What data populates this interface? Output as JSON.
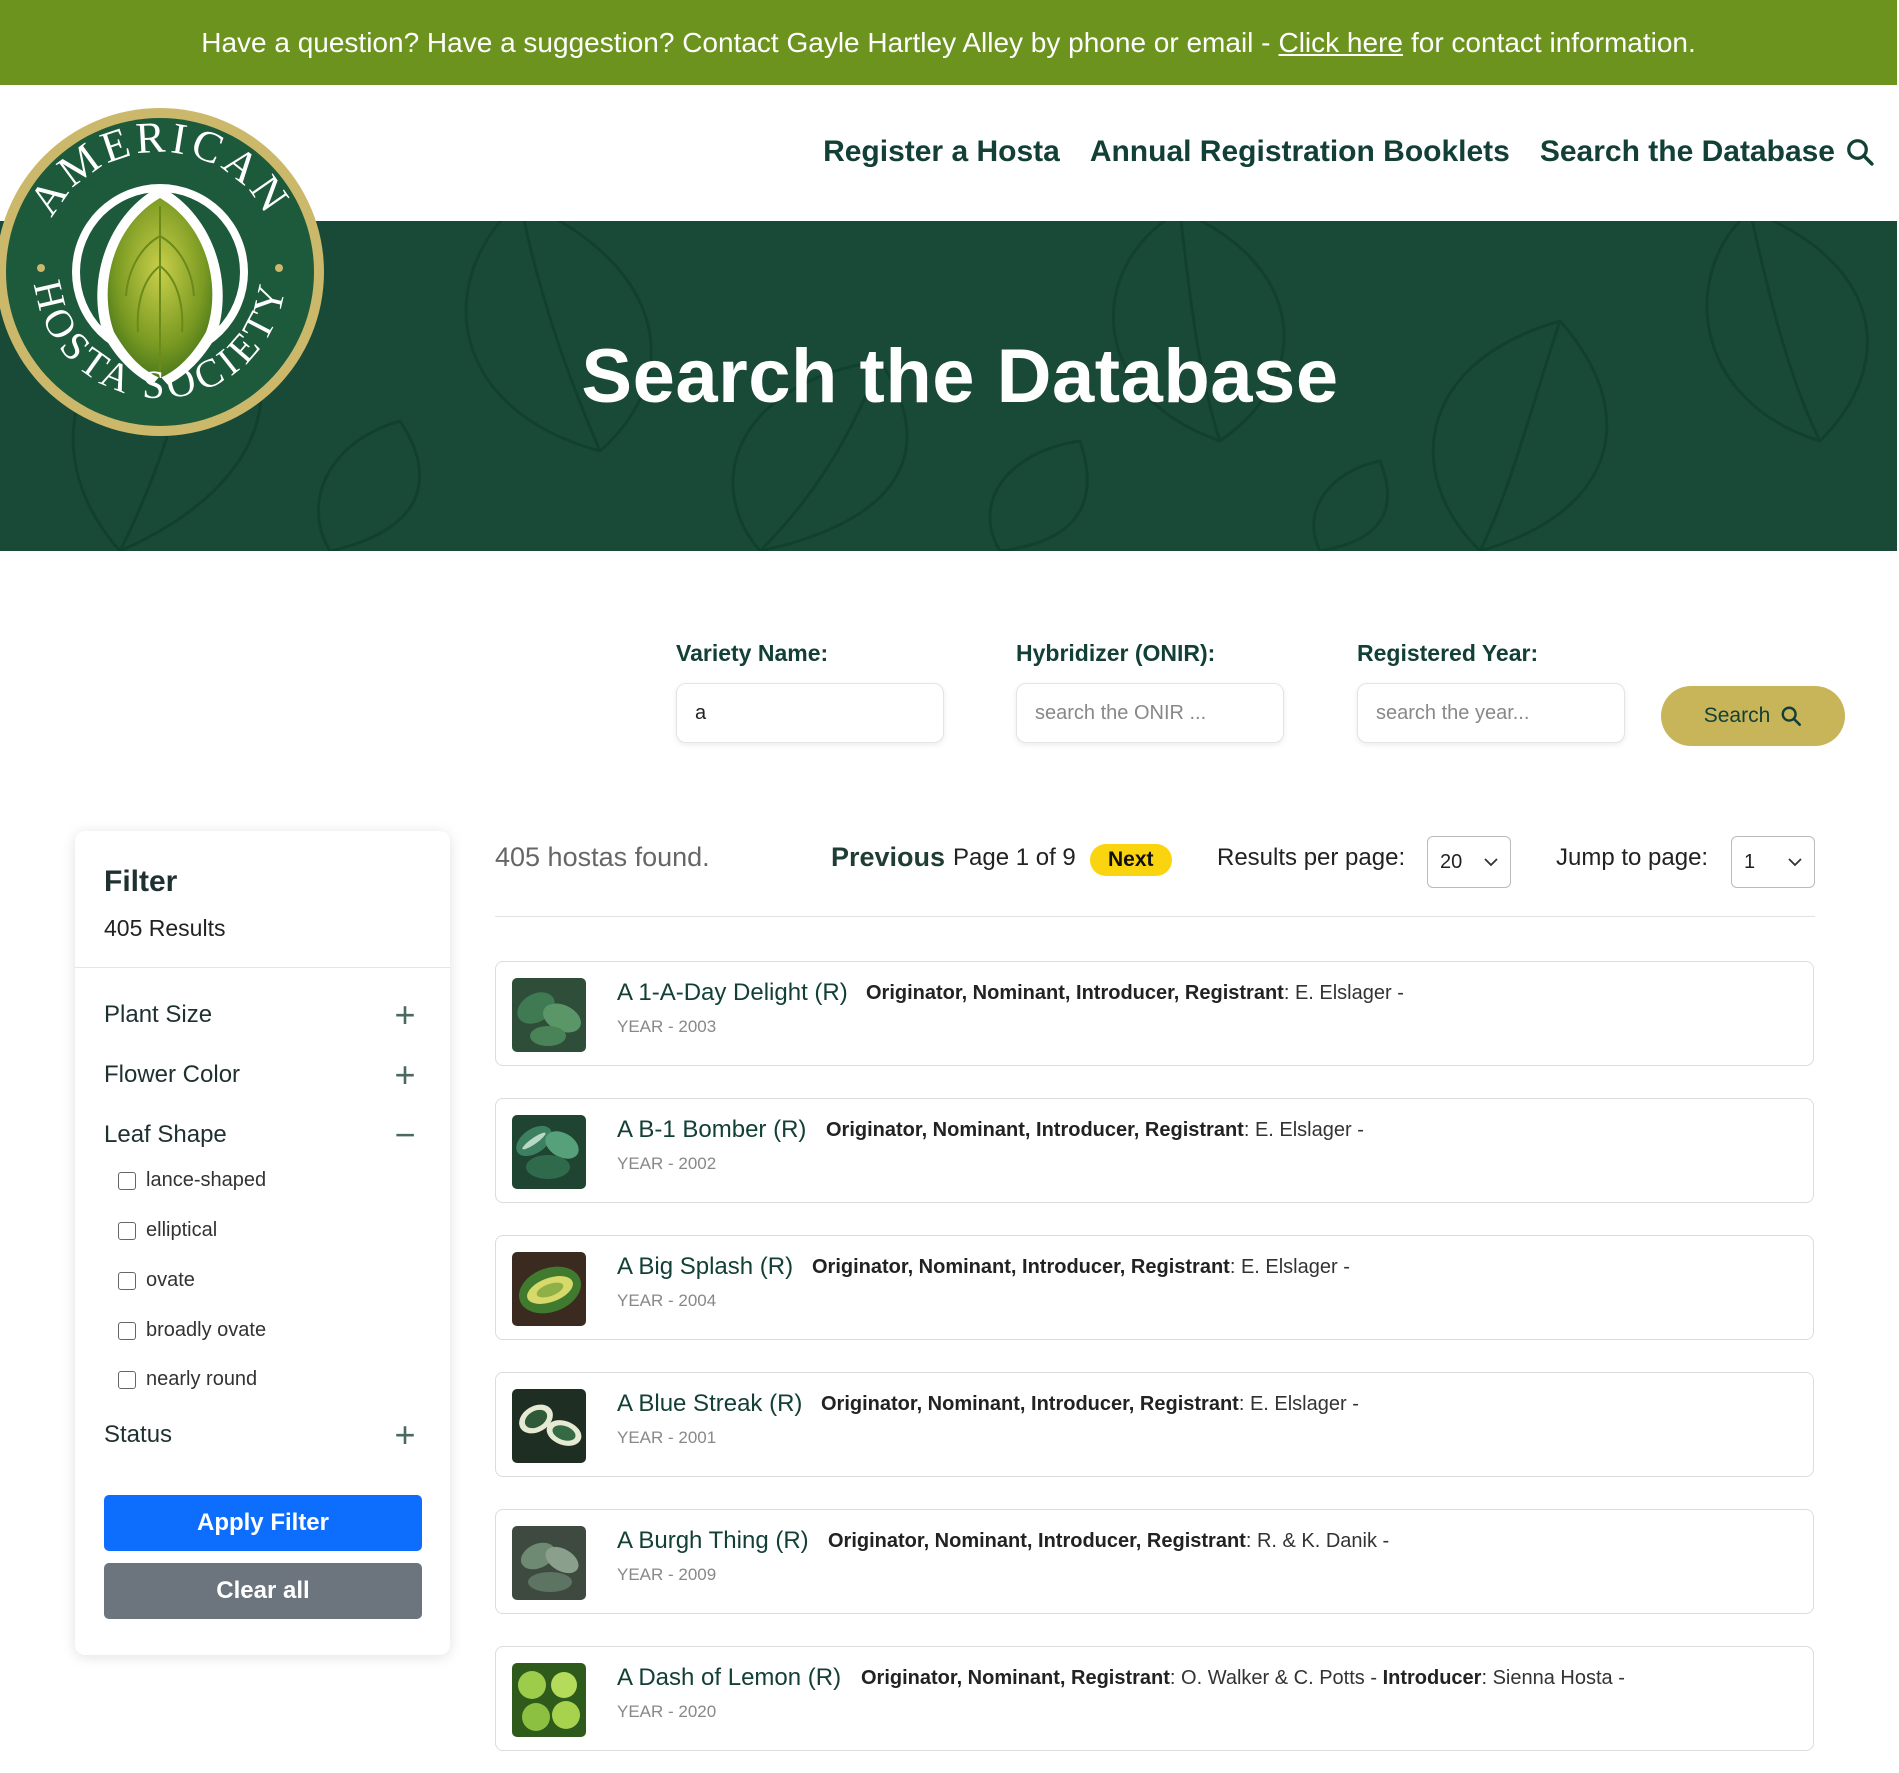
{
  "banner": {
    "text_before": "Have a question? Have a suggestion? Contact Gayle Hartley Alley by phone or email -",
    "link": "Click here",
    "text_after": "for contact information."
  },
  "logo": {
    "text": "AMERICAN HOSTA SOCIETY"
  },
  "nav": {
    "items": [
      "Register a Hosta",
      "Annual Registration Booklets",
      "Search the Database"
    ]
  },
  "hero": {
    "title": "Search the Database"
  },
  "search": {
    "variety_label": "Variety Name:",
    "variety_value": "a",
    "hybridizer_label": "Hybridizer (ONIR):",
    "hybridizer_placeholder": "search the ONIR ...",
    "year_label": "Registered Year:",
    "year_placeholder": "search the year...",
    "button": "Search"
  },
  "filter": {
    "title": "Filter",
    "results": "405 Results",
    "facets": [
      {
        "label": "Plant Size",
        "toggle": "+"
      },
      {
        "label": "Flower Color",
        "toggle": "+"
      },
      {
        "label": "Leaf Shape",
        "toggle": "−"
      },
      {
        "label": "Status",
        "toggle": "+"
      }
    ],
    "leaf_options": [
      "lance-shaped",
      "elliptical",
      "ovate",
      "broadly ovate",
      "nearly round"
    ],
    "apply": "Apply Filter",
    "clear": "Clear all"
  },
  "results_bar": {
    "found": "405 hostas found.",
    "previous": "Previous",
    "page_info": "Page 1 of 9",
    "next": "Next",
    "per_page_label": "Results per page:",
    "per_page_value": "20",
    "jump_label": "Jump to page:",
    "jump_value": "1"
  },
  "results": [
    {
      "name": "A 1-A-Day Delight (R)",
      "roles1": "Originator, Nominant, Introducer, Registrant",
      "names1": ": E. Elslager -",
      "roles2": "",
      "names2": "",
      "year": "YEAR - 2003"
    },
    {
      "name": "A B-1 Bomber (R)",
      "roles1": "Originator, Nominant, Introducer, Registrant",
      "names1": ": E. Elslager -",
      "roles2": "",
      "names2": "",
      "year": "YEAR - 2002"
    },
    {
      "name": "A Big Splash (R)",
      "roles1": "Originator, Nominant, Introducer, Registrant",
      "names1": ": E. Elslager -",
      "roles2": "",
      "names2": "",
      "year": "YEAR - 2004"
    },
    {
      "name": "A Blue Streak (R)",
      "roles1": "Originator, Nominant, Introducer, Registrant",
      "names1": ": E. Elslager -",
      "roles2": "",
      "names2": "",
      "year": "YEAR - 2001"
    },
    {
      "name": "A Burgh Thing (R)",
      "roles1": "Originator, Nominant, Introducer, Registrant",
      "names1": ": R. & K. Danik -",
      "roles2": "",
      "names2": "",
      "year": "YEAR - 2009"
    },
    {
      "name": "A Dash of Lemon (R)",
      "roles1": "Originator, Nominant, Registrant",
      "names1": ": O. Walker & C. Potts -",
      "roles2": "Introducer",
      "names2": ": Sienna Hosta -",
      "year": "YEAR - 2020"
    }
  ],
  "colors": {
    "banner": "#6b931d",
    "hero": "#184a37",
    "gold": "#c8b55a",
    "next_badge": "#fad40e",
    "apply": "#0d6efd",
    "clear": "#6c757d",
    "heading_green": "#134036"
  }
}
